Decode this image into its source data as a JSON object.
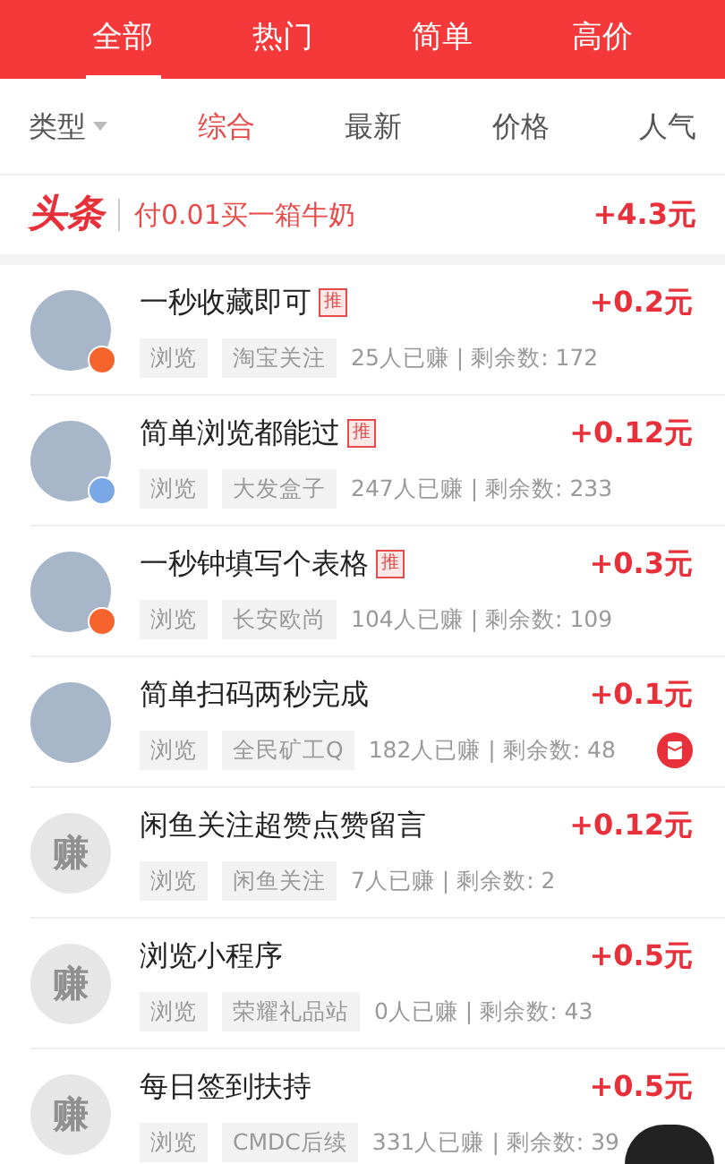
{
  "top_tabs": [
    {
      "label": "全部",
      "selected": true
    },
    {
      "label": "热门",
      "selected": false
    },
    {
      "label": "简单",
      "selected": false
    },
    {
      "label": "高价",
      "selected": false
    }
  ],
  "sort_bar": {
    "type_label": "类型",
    "options": [
      {
        "label": "综合",
        "selected": true
      },
      {
        "label": "最新",
        "selected": false
      },
      {
        "label": "价格",
        "selected": false
      },
      {
        "label": "人气",
        "selected": false
      }
    ]
  },
  "headline": {
    "logo": "头条",
    "text": "付0.01买一箱牛奶",
    "reward": "+4.3元"
  },
  "tasks": [
    {
      "avatar": {
        "kind": "photo"
      },
      "level_badge": {
        "color": "#f5642d"
      },
      "title": "一秒收藏即可",
      "recommended": true,
      "recommend_label": "推",
      "tags": [
        "浏览",
        "淘宝关注"
      ],
      "stats": "25人已赚 | 剩余数: 172",
      "reward": "+0.2元",
      "red_packet": false
    },
    {
      "avatar": {
        "kind": "photo"
      },
      "level_badge": {
        "color": "#7aa7e6"
      },
      "title": "简单浏览都能过",
      "recommended": true,
      "recommend_label": "推",
      "tags": [
        "浏览",
        "大发盒子"
      ],
      "stats": "247人已赚 | 剩余数: 233",
      "reward": "+0.12元",
      "red_packet": false
    },
    {
      "avatar": {
        "kind": "photo"
      },
      "level_badge": {
        "color": "#f5642d"
      },
      "title": "一秒钟填写个表格",
      "recommended": true,
      "recommend_label": "推",
      "tags": [
        "浏览",
        "长安欧尚"
      ],
      "stats": "104人已赚 | 剩余数: 109",
      "reward": "+0.3元",
      "red_packet": false
    },
    {
      "avatar": {
        "kind": "photo"
      },
      "title": "简单扫码两秒完成",
      "recommended": false,
      "tags": [
        "浏览",
        "全民矿工Q"
      ],
      "stats": "182人已赚 | 剩余数: 48",
      "reward": "+0.1元",
      "red_packet": true
    },
    {
      "avatar": {
        "kind": "placeholder",
        "text": "赚"
      },
      "title": "闲鱼关注超赞点赞留言",
      "recommended": false,
      "tags": [
        "浏览",
        "闲鱼关注"
      ],
      "stats": "7人已赚 | 剩余数: 2",
      "reward": "+0.12元",
      "red_packet": false
    },
    {
      "avatar": {
        "kind": "placeholder",
        "text": "赚"
      },
      "title": "浏览小程序",
      "recommended": false,
      "tags": [
        "浏览",
        "荣耀礼品站"
      ],
      "stats": "0人已赚 | 剩余数: 43",
      "reward": "+0.5元",
      "red_packet": false
    },
    {
      "avatar": {
        "kind": "placeholder",
        "text": "赚"
      },
      "title": "每日签到扶持",
      "recommended": false,
      "tags": [
        "浏览",
        "CMDC后续"
      ],
      "stats": "331人已赚 | 剩余数: 39",
      "reward": "+0.5元",
      "red_packet": false
    }
  ]
}
